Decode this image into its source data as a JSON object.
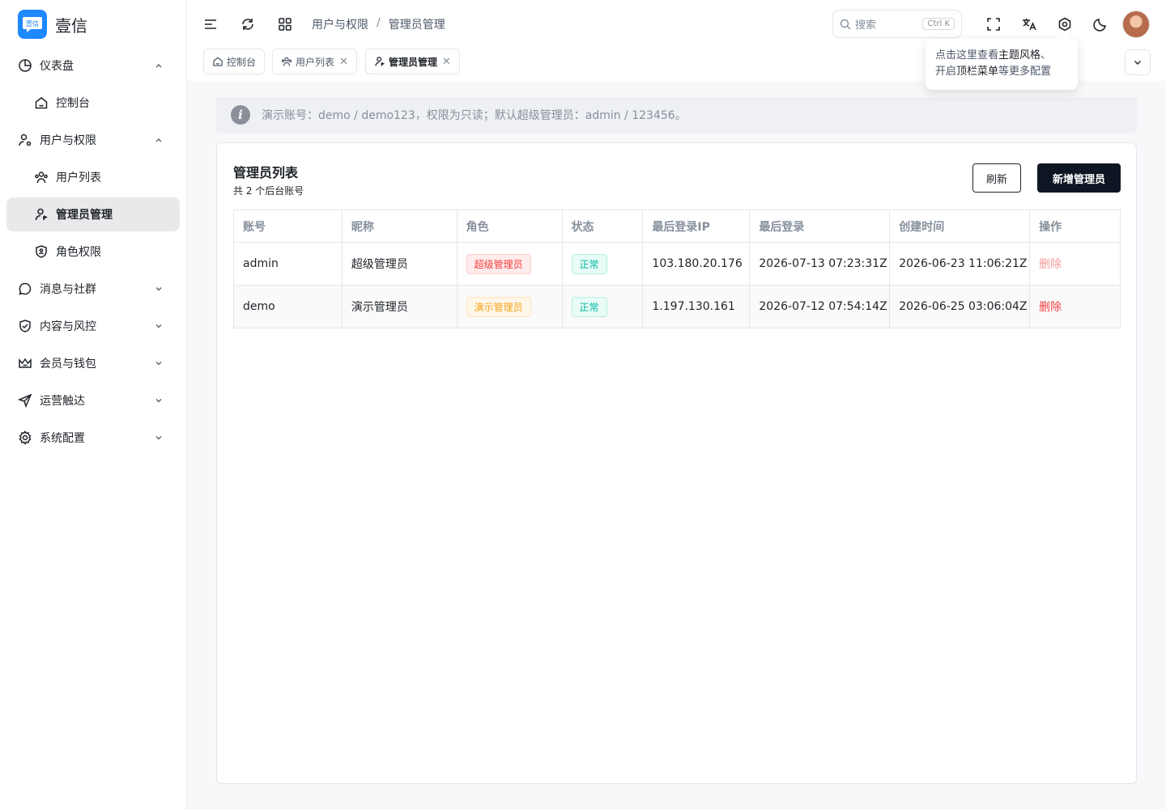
{
  "brand": {
    "name": "壹信",
    "logo_text": "壹信"
  },
  "sidebar": {
    "items": [
      {
        "label": "仪表盘",
        "icon": "pie-chart-icon",
        "expanded": true
      },
      {
        "label": "控制台",
        "icon": "home-icon",
        "sub": true
      },
      {
        "label": "用户与权限",
        "icon": "user-settings-icon",
        "expanded": true
      },
      {
        "label": "用户列表",
        "icon": "users-icon",
        "sub": true
      },
      {
        "label": "管理员管理",
        "icon": "user-admin-icon",
        "sub": true,
        "active": true
      },
      {
        "label": "角色权限",
        "icon": "shield-user-icon",
        "sub": true
      },
      {
        "label": "消息与社群",
        "icon": "chat-icon",
        "expanded": false
      },
      {
        "label": "内容与风控",
        "icon": "shield-check-icon",
        "expanded": false
      },
      {
        "label": "会员与钱包",
        "icon": "crown-icon",
        "expanded": false
      },
      {
        "label": "运营触达",
        "icon": "send-icon",
        "expanded": false
      },
      {
        "label": "系统配置",
        "icon": "gear-icon",
        "expanded": false
      }
    ]
  },
  "header": {
    "breadcrumb": [
      "用户与权限",
      "管理员管理"
    ],
    "breadcrumb_sep": "/",
    "search_placeholder": "搜索",
    "search_shortcut": "Ctrl K"
  },
  "tabs": [
    {
      "label": "控制台",
      "icon": "home-icon",
      "closable": false
    },
    {
      "label": "用户列表",
      "icon": "users-icon",
      "closable": true
    },
    {
      "label": "管理员管理",
      "icon": "user-admin-icon",
      "closable": true,
      "active": true
    }
  ],
  "tooltip": {
    "line1_pre": "点击这里查看",
    "line1_bold": "主题风格",
    "line1_post": "、",
    "line2_pre": "开启",
    "line2_bold": "顶栏菜单",
    "line2_post": "等更多配置"
  },
  "notice": {
    "text": "演示账号：demo / demo123，权限为只读；默认超级管理员：admin / 123456。"
  },
  "card": {
    "title": "管理员列表",
    "subtitle": "共 2 个后台账号",
    "refresh_label": "刷新",
    "add_label": "新增管理员"
  },
  "table": {
    "headers": [
      "账号",
      "昵称",
      "角色",
      "状态",
      "最后登录IP",
      "最后登录",
      "创建时间",
      "操作"
    ],
    "rows": [
      {
        "account": "admin",
        "nickname": "超级管理员",
        "role": "超级管理员",
        "status": "正常",
        "ip": "103.180.20.176",
        "last_login": "2026-07-13 07:23:31Z",
        "created": "2026-06-23 11:06:21Z",
        "action": "删除"
      },
      {
        "account": "demo",
        "nickname": "演示管理员",
        "role": "演示管理员",
        "status": "正常",
        "ip": "1.197.130.161",
        "last_login": "2026-07-12 07:54:14Z",
        "created": "2026-06-25 03:06:04Z",
        "action": "删除"
      }
    ]
  },
  "colors": {
    "accent": "#0f1623",
    "danger": "#f53f3f",
    "success": "#00b8a0",
    "warning": "#f7a21b",
    "brand": "#1e88ff"
  }
}
